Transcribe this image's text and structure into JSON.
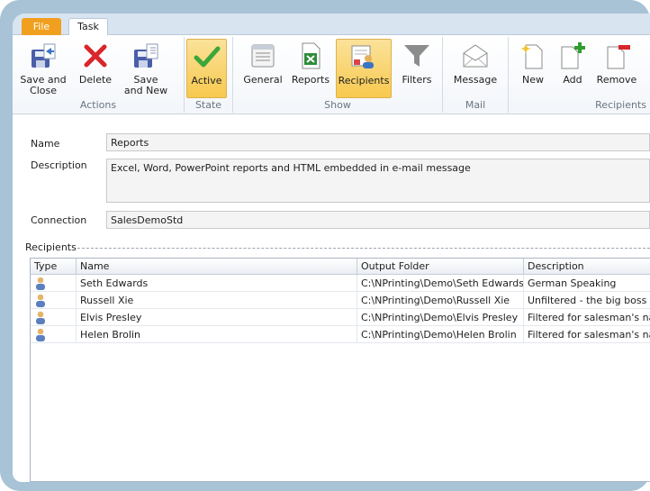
{
  "tabs": {
    "file": "File",
    "task": "Task"
  },
  "ribbon": {
    "groups": {
      "actions": "Actions",
      "state": "State",
      "show": "Show",
      "mail": "Mail",
      "recipients": "Recipients"
    },
    "buttons": {
      "save_close": [
        "Save and",
        "Close"
      ],
      "delete": "Delete",
      "save_new": [
        "Save",
        "and New"
      ],
      "active": "Active",
      "general": "General",
      "reports": "Reports",
      "recipients": "Recipients",
      "filters": "Filters",
      "message": "Message",
      "new": "New",
      "add": "Add",
      "remove": "Remove"
    }
  },
  "form": {
    "name_label": "Name",
    "name_value": "Reports",
    "description_label": "Description",
    "description_value": "Excel, Word, PowerPoint  reports and HTML embedded in e-mail message",
    "connection_label": "Connection",
    "connection_value": "SalesDemoStd"
  },
  "recipients_section": "Recipients",
  "grid": {
    "columns": [
      "Type",
      "Name",
      "Output Folder",
      "Description"
    ],
    "rows": [
      {
        "name": "Seth Edwards",
        "folder": "C:\\NPrinting\\Demo\\Seth Edwards",
        "description": "German Speaking"
      },
      {
        "name": "Russell Xie",
        "folder": "C:\\NPrinting\\Demo\\Russell Xie",
        "description": "Unfiltered - the big boss"
      },
      {
        "name": "Elvis Presley",
        "folder": "C:\\NPrinting\\Demo\\Elvis Presley",
        "description": "Filtered for salesman's na"
      },
      {
        "name": "Helen Brolin",
        "folder": "C:\\NPrinting\\Demo\\Helen Brolin",
        "description": "Filtered for salesman's na"
      }
    ]
  },
  "colors": {
    "accent_file": "#f0a01e",
    "active_button": "#f7c94e",
    "frame": "#a9c3d6"
  },
  "icons": [
    "save-close-icon",
    "delete-icon",
    "save-new-icon",
    "check-icon",
    "general-icon",
    "reports-icon",
    "recipients-icon",
    "filter-icon",
    "message-icon",
    "new-doc-icon",
    "add-doc-icon",
    "remove-doc-icon",
    "person-icon"
  ]
}
